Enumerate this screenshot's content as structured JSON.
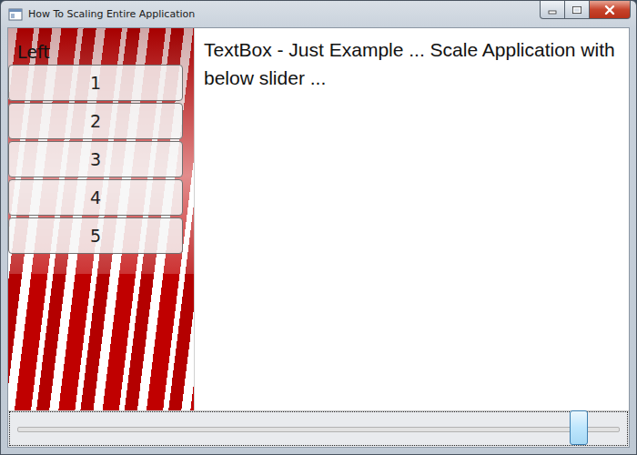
{
  "window": {
    "title": "How To Scaling Entire Application"
  },
  "sidebar": {
    "label": "Left",
    "items": [
      {
        "label": "1"
      },
      {
        "label": "2"
      },
      {
        "label": "3"
      },
      {
        "label": "4"
      },
      {
        "label": "5"
      }
    ]
  },
  "textbox": {
    "value": "TextBox - Just Example ... Scale Application with below slider ..."
  },
  "slider": {
    "level": 0.95,
    "focused": true
  }
}
